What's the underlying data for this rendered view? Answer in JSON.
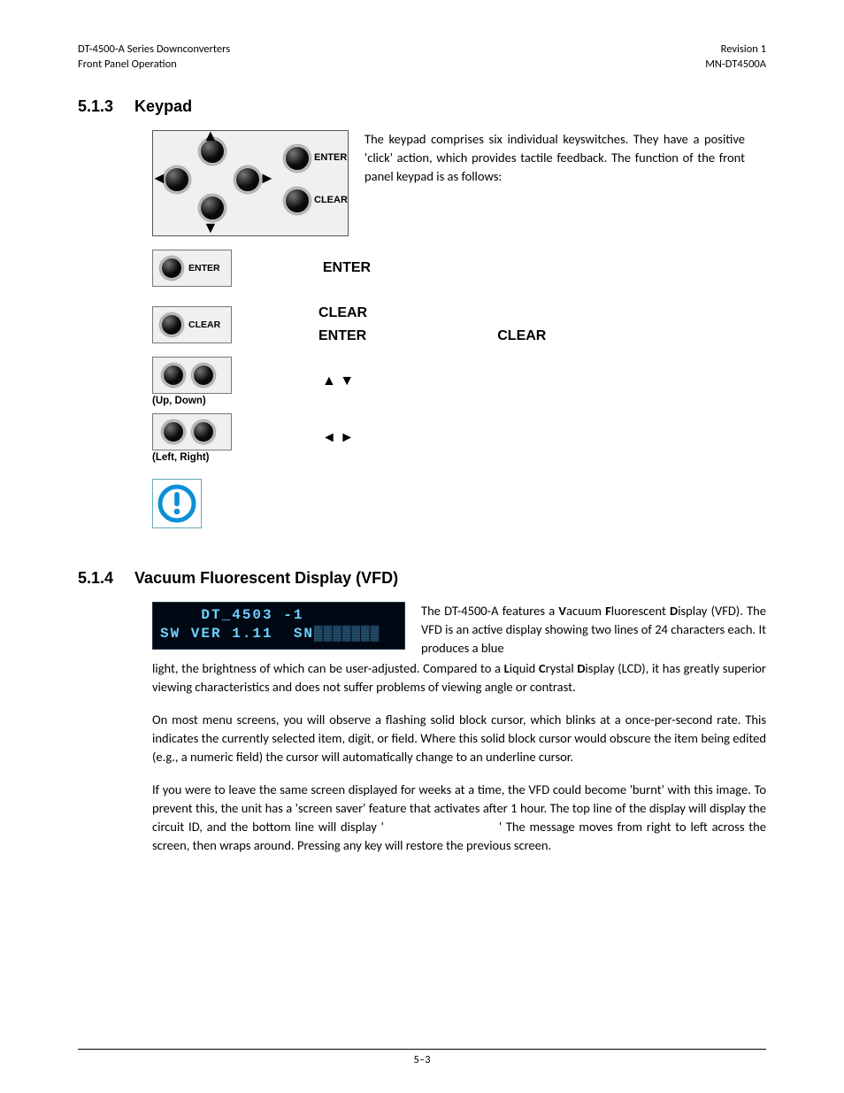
{
  "header": {
    "left1": "DT-4500-A Series Downconverters",
    "left2": "Front Panel Operation",
    "right1": "Revision 1",
    "right2": "MN-DT4500A"
  },
  "s513": {
    "num": "5.1.3",
    "title": "Keypad",
    "intro": "The keypad comprises six individual keyswitches. They have a positive 'click' action, which provides tactile feedback. The function of the front panel keypad is as follows:",
    "enter_label": "ENTER",
    "clear_label": "CLEAR",
    "enter_big": "ENTER",
    "clear_big": "CLEAR",
    "updown_arrows": "▲ ▼",
    "leftright_arrows": "◄ ►",
    "updown_sub": "(Up, Down)",
    "leftright_sub": "(Left, Right)"
  },
  "s514": {
    "num": "5.1.4",
    "title": "Vacuum Fluorescent Display (VFD)",
    "vfd_line1": "    DT_4503 -1",
    "vfd_line2": "SW VER 1.11  SN",
    "p1a": "The DT-4500-A features a ",
    "p1b": "acuum ",
    "p1c": "luorescent ",
    "p1d": "isplay (VFD). The VFD is an active display showing two lines of 24 characters each. It produces a blue",
    "p1e": "light, the brightness of which can be user-adjusted. Compared to a ",
    "p1f": "iquid ",
    "p1g": "rystal ",
    "p1h": "isplay (LCD), it has greatly superior viewing characteristics and does not suffer problems of viewing angle or contrast.",
    "p2": "On most menu screens, you will observe a flashing solid block cursor, which blinks at a once-per-second rate. This indicates the currently selected item, digit, or field. Where this solid block cursor would obscure the item being edited (e.g., a numeric field) the cursor will automatically change to an underline cursor.",
    "p3a": "If you were to leave the same screen displayed for weeks at a time, the VFD could become 'burnt' with this image. To prevent this, the unit has a 'screen saver' feature that activates after 1 hour. The top line of the display will display the circuit ID, and the bottom line will display '",
    "p3b": "' The message moves from right to left across the screen, then wraps around. Pressing any key will restore the previous screen."
  },
  "bold": {
    "V": "V",
    "F": "F",
    "D": "D",
    "L": "L",
    "C": "C"
  },
  "page_number": "5–3"
}
